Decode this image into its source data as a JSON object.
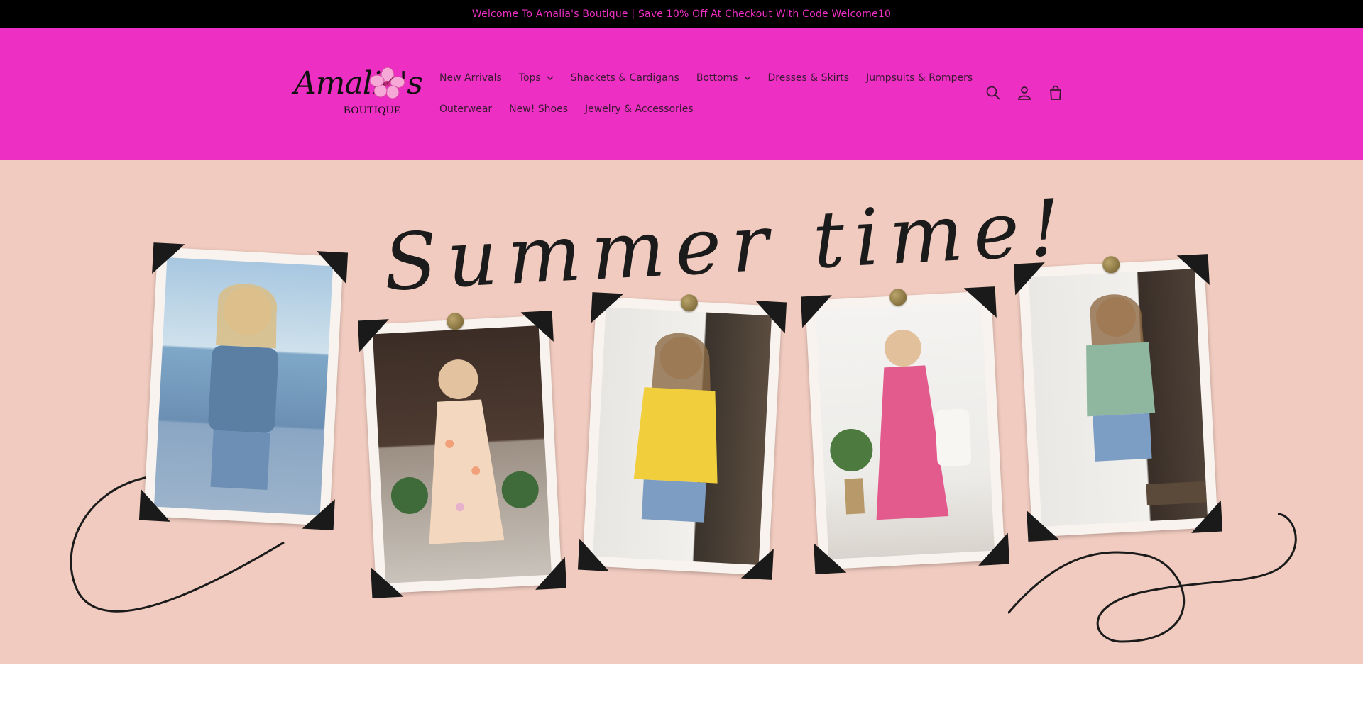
{
  "announcement": {
    "text": "Welcome To Amalia's Boutique | Save 10% Off At Checkout With Code Welcome10"
  },
  "brand": {
    "logo_script": "Amalia's",
    "logo_sub": "BOUTIQUE",
    "header_color": "#ee2fc3",
    "announcement_text_color": "#ee2fc3"
  },
  "nav": {
    "row1": [
      {
        "label": "New Arrivals",
        "has_dropdown": false
      },
      {
        "label": "Tops",
        "has_dropdown": true
      },
      {
        "label": "Shackets & Cardigans",
        "has_dropdown": false
      },
      {
        "label": "Bottoms",
        "has_dropdown": true
      },
      {
        "label": "Dresses & Skirts",
        "has_dropdown": false
      },
      {
        "label": "Jumpsuits & Rompers",
        "has_dropdown": false
      }
    ],
    "row2": [
      {
        "label": "Outerwear",
        "has_dropdown": false
      },
      {
        "label": "New! Shoes",
        "has_dropdown": false
      },
      {
        "label": "Jewelry & Accessories",
        "has_dropdown": false
      }
    ]
  },
  "header_icons": [
    "search-icon",
    "account-icon",
    "cart-icon"
  ],
  "hero": {
    "title": "Summer time!",
    "background_color": "#f1cbbf",
    "photos": [
      {
        "outfit": "blue smocked top with denim shorts"
      },
      {
        "outfit": "floral midi dress"
      },
      {
        "outfit": "yellow peasant top with denim shorts"
      },
      {
        "outfit": "pink tiered maxi dress"
      },
      {
        "outfit": "green striped sleeveless top with denim shorts"
      }
    ]
  }
}
